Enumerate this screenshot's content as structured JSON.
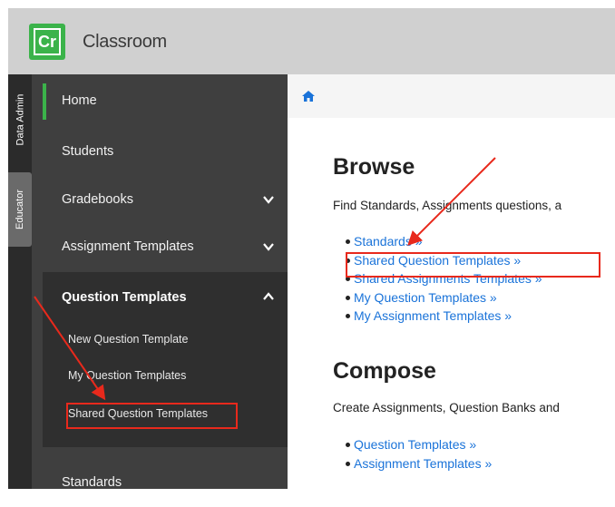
{
  "app": {
    "logo_text": "Cr",
    "title": "Classroom"
  },
  "rail": {
    "tabs": [
      "Data Admin",
      "Educator"
    ]
  },
  "sidebar": {
    "items": [
      {
        "label": "Home",
        "active": true
      },
      {
        "label": "Students"
      },
      {
        "label": "Gradebooks",
        "chevron": "chevron-down-icon"
      },
      {
        "label": "Assignment Templates",
        "chevron": "chevron-down-icon"
      },
      {
        "label": "Standards"
      }
    ],
    "submenu": {
      "label": "Question Templates",
      "chevron": "chevron-up-icon",
      "items": [
        "New Question Template",
        "My Question Templates",
        "Shared Question Templates"
      ]
    }
  },
  "breadcrumb": {
    "icon": "home-icon"
  },
  "main": {
    "browse": {
      "heading": "Browse",
      "description": "Find Standards, Assignments questions, a",
      "links": [
        "Standards »",
        "Shared Question Templates »",
        "Shared Assignments Templates »",
        "My Question Templates »",
        "My Assignment Templates »"
      ]
    },
    "compose": {
      "heading": "Compose",
      "description": "Create Assignments, Question Banks and",
      "links": [
        "Question Templates »",
        "Assignment Templates »"
      ]
    }
  },
  "colors": {
    "accent": "#3bb34a",
    "link": "#1a73d9",
    "annotation": "#e8291c",
    "sidebar": "#3f3f3f"
  }
}
